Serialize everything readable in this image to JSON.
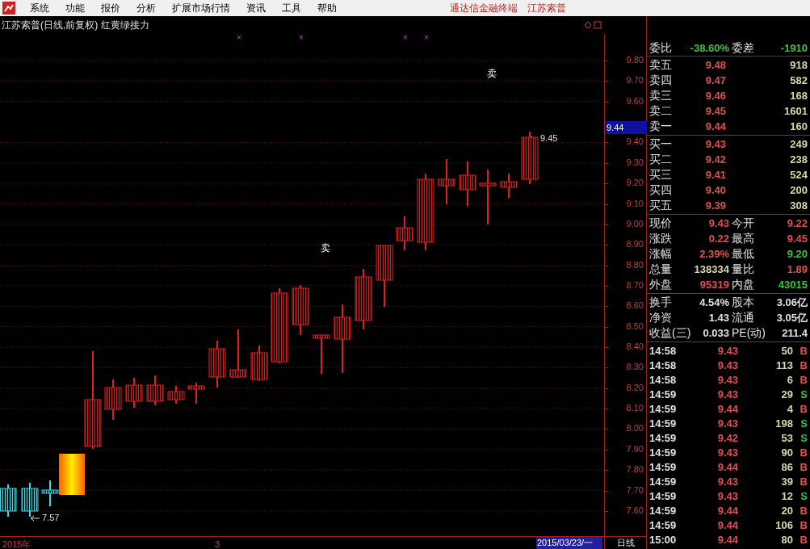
{
  "menu": {
    "items": [
      "系统",
      "功能",
      "报价",
      "分析",
      "扩展市场行情",
      "资讯",
      "工具",
      "帮助"
    ],
    "app_name": "通达信金融终端",
    "stock_name": "江苏索普"
  },
  "chart": {
    "title": "江苏索普(日线,前复权) 红黄绿接力",
    "markers": [
      "×",
      "×",
      "×",
      "×"
    ],
    "signals": [
      "卖",
      "卖"
    ],
    "high_label": "9.45",
    "low_label": "7.57",
    "y_ticks": [
      "9.80",
      "9.70",
      "9.60",
      "9.40",
      "9.30",
      "9.20",
      "9.10",
      "9.00",
      "8.90",
      "8.80",
      "8.70",
      "8.60",
      "8.50",
      "8.40",
      "8.30",
      "8.20",
      "8.10",
      "8.00",
      "7.90",
      "7.80",
      "7.70",
      "7.60"
    ],
    "current_price": "9.44",
    "x_labels": [
      "2015年",
      "3"
    ],
    "cursor_date": "2015/03/23/一",
    "period": "日线"
  },
  "quote": {
    "ratio_row": [
      {
        "label": "委比",
        "value": "-38.60%",
        "color": "#40c040"
      },
      {
        "label": "委差",
        "value": "-1910",
        "color": "#40c040"
      }
    ],
    "asks": [
      {
        "label": "卖五",
        "price": "9.48",
        "volume": "918"
      },
      {
        "label": "卖四",
        "price": "9.47",
        "volume": "582"
      },
      {
        "label": "卖三",
        "price": "9.46",
        "volume": "168"
      },
      {
        "label": "卖二",
        "price": "9.45",
        "volume": "1601"
      },
      {
        "label": "卖一",
        "price": "9.44",
        "volume": "160"
      }
    ],
    "bids": [
      {
        "label": "买一",
        "price": "9.43",
        "volume": "249"
      },
      {
        "label": "买二",
        "price": "9.42",
        "volume": "238"
      },
      {
        "label": "买三",
        "price": "9.41",
        "volume": "524"
      },
      {
        "label": "买四",
        "price": "9.40",
        "volume": "200"
      },
      {
        "label": "买五",
        "price": "9.39",
        "volume": "308"
      }
    ],
    "stats": [
      [
        {
          "label": "现价",
          "value": "9.43",
          "color": "#e05050"
        },
        {
          "label": "今开",
          "value": "9.22",
          "color": "#e05050"
        }
      ],
      [
        {
          "label": "涨跌",
          "value": "0.22",
          "color": "#e05050"
        },
        {
          "label": "最高",
          "value": "9.45",
          "color": "#e05050"
        }
      ],
      [
        {
          "label": "涨幅",
          "value": "2.39%",
          "color": "#e05050"
        },
        {
          "label": "最低",
          "value": "9.20",
          "color": "#40c040"
        }
      ],
      [
        {
          "label": "总量",
          "value": "138334",
          "color": "#d8d8a8"
        },
        {
          "label": "量比",
          "value": "1.89",
          "color": "#e05050"
        }
      ],
      [
        {
          "label": "外盘",
          "value": "95319",
          "color": "#e05050"
        },
        {
          "label": "内盘",
          "value": "43015",
          "color": "#40c040"
        }
      ]
    ],
    "fundamentals": [
      [
        {
          "label": "换手",
          "value": "4.54%"
        },
        {
          "label": "股本",
          "value": "3.06亿"
        }
      ],
      [
        {
          "label": "净资",
          "value": "1.43"
        },
        {
          "label": "流通",
          "value": "3.05亿"
        }
      ],
      [
        {
          "label": "收益(三)",
          "value": "0.033"
        },
        {
          "label": "PE(动)",
          "value": "211.4"
        }
      ]
    ],
    "trades": [
      {
        "time": "14:58",
        "price": "9.43",
        "volume": "50",
        "side": "B",
        "kind": "buy"
      },
      {
        "time": "14:58",
        "price": "9.43",
        "volume": "113",
        "side": "B",
        "kind": "buy"
      },
      {
        "time": "14:58",
        "price": "9.43",
        "volume": "6",
        "side": "B",
        "kind": "buy"
      },
      {
        "time": "14:59",
        "price": "9.43",
        "volume": "29",
        "side": "S",
        "kind": "sell"
      },
      {
        "time": "14:59",
        "price": "9.44",
        "volume": "4",
        "side": "B",
        "kind": "buy"
      },
      {
        "time": "14:59",
        "price": "9.43",
        "volume": "198",
        "side": "S",
        "kind": "sell"
      },
      {
        "time": "14:59",
        "price": "9.42",
        "volume": "53",
        "side": "S",
        "kind": "sell"
      },
      {
        "time": "14:59",
        "price": "9.43",
        "volume": "90",
        "side": "B",
        "kind": "buy"
      },
      {
        "time": "14:59",
        "price": "9.44",
        "volume": "86",
        "side": "B",
        "kind": "buy"
      },
      {
        "time": "14:59",
        "price": "9.43",
        "volume": "39",
        "side": "B",
        "kind": "buy"
      },
      {
        "time": "14:59",
        "price": "9.43",
        "volume": "12",
        "side": "S",
        "kind": "sell"
      },
      {
        "time": "14:59",
        "price": "9.44",
        "volume": "20",
        "side": "B",
        "kind": "buy"
      },
      {
        "time": "14:59",
        "price": "9.44",
        "volume": "106",
        "side": "B",
        "kind": "buy"
      },
      {
        "time": "15:00",
        "price": "9.44",
        "volume": "80",
        "side": "B",
        "kind": "buy"
      }
    ]
  }
}
